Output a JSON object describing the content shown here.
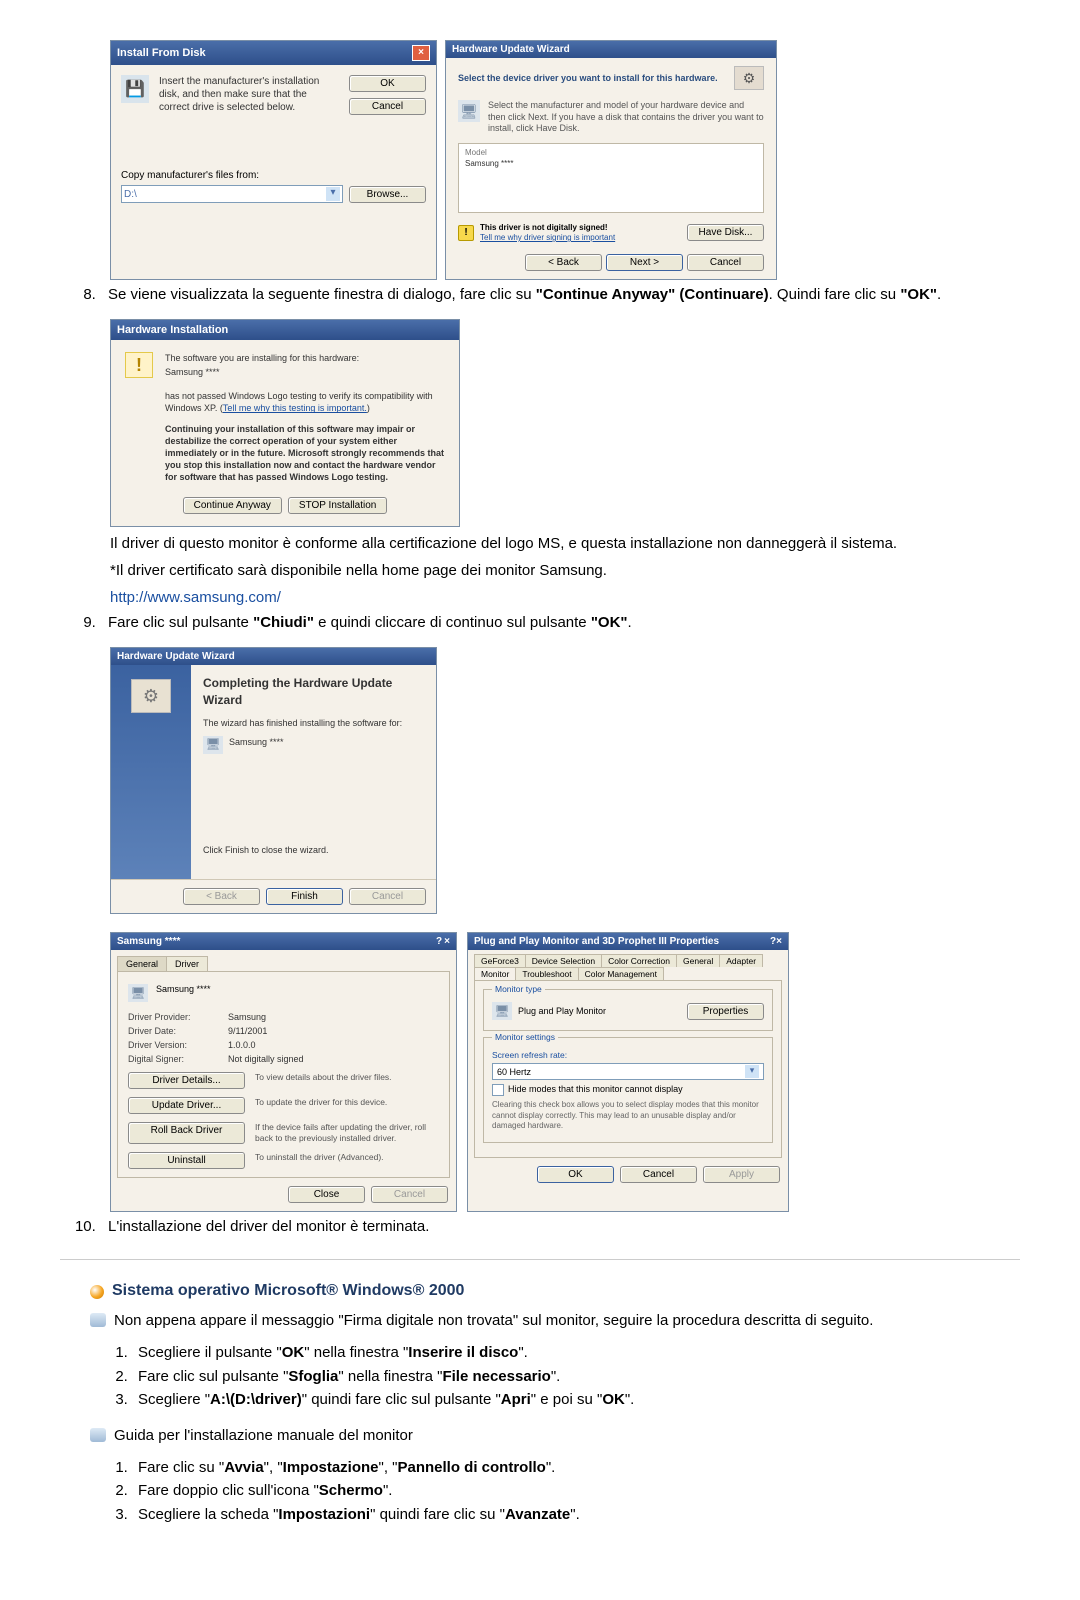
{
  "installFromDisk": {
    "title": "Install From Disk",
    "instruction": "Insert the manufacturer's installation disk, and then make sure that the correct drive is selected below.",
    "ok": "OK",
    "cancel": "Cancel",
    "copyLabel": "Copy manufacturer's files from:",
    "path": "D:\\",
    "browse": "Browse..."
  },
  "huwSelect": {
    "title": "Hardware Update Wizard",
    "heading": "Select the device driver you want to install for this hardware.",
    "instruction": "Select the manufacturer and model of your hardware device and then click Next. If you have a disk that contains the driver you want to install, click Have Disk.",
    "modelHdr": "Model",
    "modelVal": "Samsung ****",
    "warnBold": "This driver is not digitally signed!",
    "warnLink": "Tell me why driver signing is important",
    "haveDisk": "Have Disk...",
    "back": "< Back",
    "next": "Next >",
    "cancel": "Cancel"
  },
  "steps": {
    "s8_a": "Se viene visualizzata la seguente finestra di dialogo, fare clic su ",
    "s8_b1": "\"Continue Anyway\" (Continuare)",
    "s8_c": ". Quindi fare clic su ",
    "s8_b2": "\"OK\"",
    "s8_d": "."
  },
  "hi": {
    "title": "Hardware Installation",
    "line1": "The software you are installing for this hardware:",
    "device": "Samsung ****",
    "line2a": "has not passed Windows Logo testing to verify its compatibility with Windows XP. (",
    "link": "Tell me why this testing is important.",
    "line2b": ")",
    "strong": "Continuing your installation of this software may impair or destabilize the correct operation of your system either immediately or in the future. Microsoft strongly recommends that you stop this installation now and contact the hardware vendor for software that has passed Windows Logo testing.",
    "cont": "Continue Anyway",
    "stop": "STOP Installation"
  },
  "afterHi": {
    "p1": "Il driver di questo monitor è conforme alla certificazione del logo MS, e questa installazione non danneggerà il sistema.",
    "p2": "*Il driver certificato sarà disponibile nella home page dei monitor Samsung.",
    "link": "http://www.samsung.com/"
  },
  "steps9": {
    "a": "Fare clic sul pulsante ",
    "b1": "\"Chiudi\"",
    "c": " e quindi cliccare di continuo sul pulsante ",
    "b2": "\"OK\"",
    "d": "."
  },
  "huwc": {
    "title": "Hardware Update Wizard",
    "big": "Completing the Hardware Update Wizard",
    "p1": "The wizard has finished installing the software for:",
    "dev": "Samsung ****",
    "p2": "Click Finish to close the wizard.",
    "back": "< Back",
    "finish": "Finish",
    "cancel": "Cancel"
  },
  "drvtab": {
    "title": "Samsung ****",
    "tabGeneral": "General",
    "tabDriver": "Driver",
    "dev": "Samsung ****",
    "rows": [
      {
        "lbl": "Driver Provider:",
        "val": "Samsung"
      },
      {
        "lbl": "Driver Date:",
        "val": "9/11/2001"
      },
      {
        "lbl": "Driver Version:",
        "val": "1.0.0.0"
      },
      {
        "lbl": "Digital Signer:",
        "val": "Not digitally signed"
      }
    ],
    "btns": [
      {
        "lbl": "Driver Details...",
        "desc": "To view details about the driver files."
      },
      {
        "lbl": "Update Driver...",
        "desc": "To update the driver for this device."
      },
      {
        "lbl": "Roll Back Driver",
        "desc": "If the device fails after updating the driver, roll back to the previously installed driver."
      },
      {
        "lbl": "Uninstall",
        "desc": "To uninstall the driver (Advanced)."
      }
    ],
    "close": "Close",
    "cancel": "Cancel"
  },
  "pnp": {
    "title": "Plug and Play Monitor and 3D Prophet III Properties",
    "tabs": [
      "GeForce3",
      "Device Selection",
      "Color Correction",
      "General",
      "Adapter",
      "Monitor",
      "Troubleshoot",
      "Color Management"
    ],
    "monType": "Monitor type",
    "monVal": "Plug and Play Monitor",
    "properties": "Properties",
    "monSettings": "Monitor settings",
    "refresh": "Screen refresh rate:",
    "refreshVal": "60 Hertz",
    "hide": "Hide modes that this monitor cannot display",
    "note": "Clearing this check box allows you to select display modes that this monitor cannot display correctly. This may lead to an unusable display and/or damaged hardware.",
    "ok": "OK",
    "cancel": "Cancel",
    "apply": "Apply"
  },
  "step10": "L'installazione del driver del monitor è terminata.",
  "win2000": {
    "heading": "Sistema operativo Microsoft® Windows® 2000",
    "para1": "Non appena appare il messaggio \"Firma digitale non trovata\" sul monitor, seguire la procedura descritta di seguito.",
    "ol1": [
      "Scegliere il pulsante \"OK\" nella finestra \"Inserire il disco\".",
      "Fare clic sul pulsante \"Sfoglia\" nella finestra \"File necessario\".",
      "Scegliere \"A:\\(D:\\driver)\" quindi fare clic sul pulsante \"Apri\" e poi su \"OK\"."
    ],
    "guide": "Guida per l'installazione manuale del monitor",
    "ol2": [
      "Fare clic su \"Avvia\", \"Impostazione\", \"Pannello di controllo\".",
      "Fare doppio clic sull'icona \"Schermo\".",
      "Scegliere la scheda \"Impostazioni\" quindi fare clic su \"Avanzate\"."
    ]
  }
}
